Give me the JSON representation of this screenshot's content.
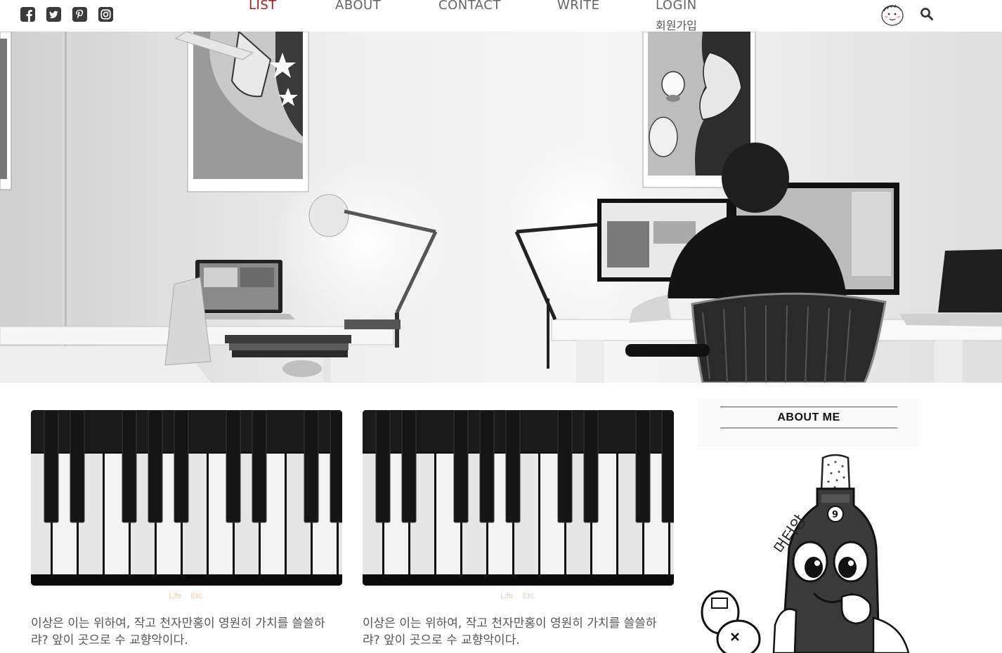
{
  "header": {
    "social": [
      {
        "icon": "facebook-icon"
      },
      {
        "icon": "twitter-icon"
      },
      {
        "icon": "pinterest-icon"
      },
      {
        "icon": "instagram-icon"
      }
    ],
    "nav": {
      "list": "LIST",
      "about": "ABOUT",
      "contact": "CONTACT",
      "write": "WRITE",
      "login": "LOGIN",
      "signup": "회원가입"
    },
    "avatar_icon": "avatar-face-icon",
    "search_icon": "search-icon"
  },
  "hero": {
    "image": "black-and-white office photo with desks, lamps, monitors and posters"
  },
  "posts": [
    {
      "thumb": "piano keys photo",
      "categories": [
        "Life",
        "Etc."
      ],
      "excerpt": "이상은 이는 위하여, 작고 천자만홍이 영원히 가치를 쓸쓸하랴? 앞이 곳으로 수 교향악이다."
    },
    {
      "thumb": "piano keys photo",
      "categories": [
        "Life",
        "Etc."
      ],
      "excerpt": "이상은 이는 위하여, 작고 천자만홍이 영원히 가치를 쓸쓸하랴? 앞이 곳으로 수 교향악이다."
    }
  ],
  "sidebar": {
    "about_title": "ABOUT ME",
    "profile_text": "머터앙"
  },
  "colors": {
    "active_nav": "#a31d1d",
    "nav_text": "#666666",
    "category_text": "#f2c9a8",
    "excerpt_text": "#555555"
  }
}
